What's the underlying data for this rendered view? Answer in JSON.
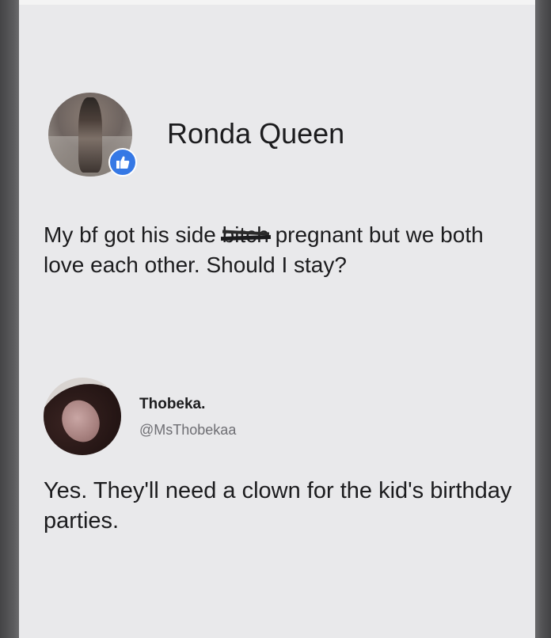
{
  "post1": {
    "author_name": "Ronda Queen",
    "badge_icon": "like-thumbs-up-icon",
    "badge_color": "#3578e5",
    "text_before": "My bf got his side ",
    "text_struck": "bitch",
    "text_after": " pregnant but we both love each other. Should I stay?"
  },
  "post2": {
    "author_name": "Thobeka.",
    "handle": "@MsThobekaa",
    "text": "Yes. They'll need a clown for the kid's birthday parties."
  }
}
